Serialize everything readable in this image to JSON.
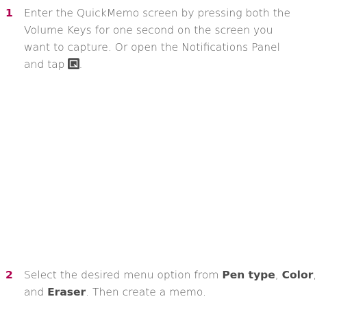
{
  "steps": [
    {
      "number": "1",
      "lines": [
        "Enter the QuickMemo screen by pressing both the",
        "Volume Keys for one second on the screen you",
        "want to capture. Or open the Notifications Panel"
      ],
      "last_line_before_icon": "and tap",
      "last_line_after_icon": ".",
      "icon": "quickmemo-icon"
    },
    {
      "number": "2",
      "line1_text": "Select the desired menu option from ",
      "line1_bold1": "Pen type",
      "line1_sep1": ", ",
      "line1_bold2": "Color",
      "line1_sep2": ",",
      "line2_prefix": "and ",
      "line2_bold": "Eraser",
      "line2_suffix": ". Then create a memo."
    }
  ]
}
